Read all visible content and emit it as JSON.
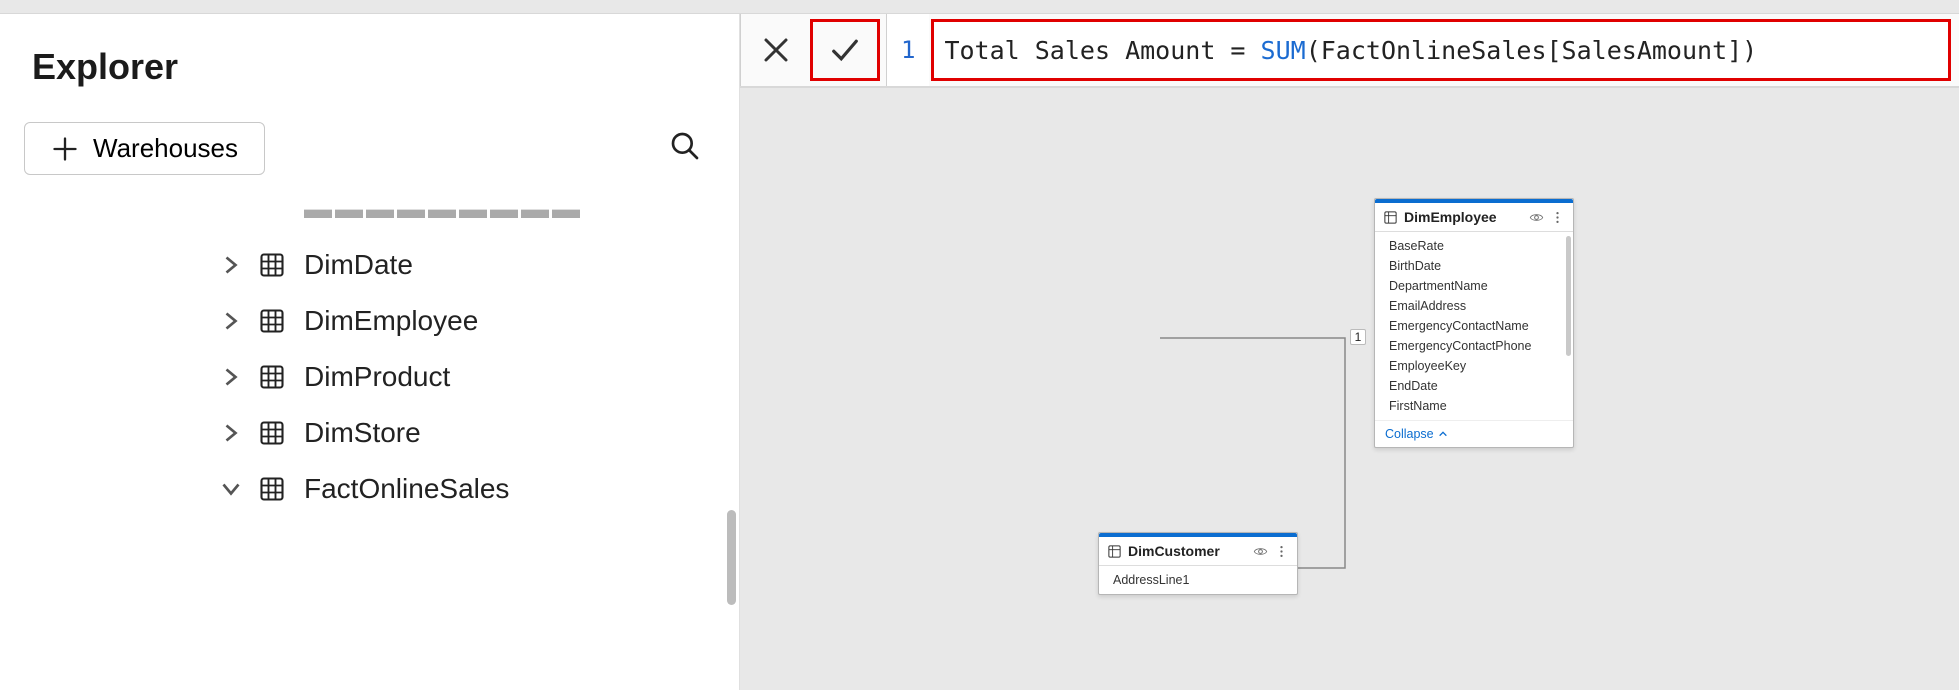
{
  "sidebar": {
    "title": "Explorer",
    "warehouses_label": "Warehouses",
    "tree": [
      {
        "label": "DimDate",
        "expanded": false
      },
      {
        "label": "DimEmployee",
        "expanded": false
      },
      {
        "label": "DimProduct",
        "expanded": false
      },
      {
        "label": "DimStore",
        "expanded": false
      },
      {
        "label": "FactOnlineSales",
        "expanded": true
      }
    ]
  },
  "formula": {
    "line_number": "1",
    "prefix": "Total Sales Amount = ",
    "func": "SUM",
    "args": "(FactOnlineSales[SalesAmount])"
  },
  "cards": {
    "dimEmployee": {
      "title": "DimEmployee",
      "fields": [
        "BaseRate",
        "BirthDate",
        "DepartmentName",
        "EmailAddress",
        "EmergencyContactName",
        "EmergencyContactPhone",
        "EmployeeKey",
        "EndDate",
        "FirstName"
      ],
      "collapse_label": "Collapse"
    },
    "dimCustomer": {
      "title": "DimCustomer",
      "fields": [
        "AddressLine1"
      ]
    }
  },
  "relationship": {
    "cardinality": "1"
  }
}
